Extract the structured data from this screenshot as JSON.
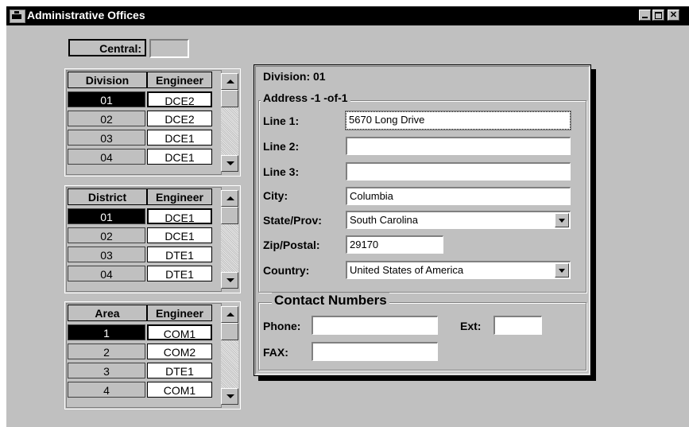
{
  "window": {
    "title": "Administrative Offices"
  },
  "central": {
    "label": "Central:",
    "value": ""
  },
  "division_grid": {
    "headers": [
      "Division",
      "Engineer"
    ],
    "rows": [
      {
        "id": "01",
        "engineer": "DCE2",
        "selected": true
      },
      {
        "id": "02",
        "engineer": "DCE2"
      },
      {
        "id": "03",
        "engineer": "DCE1"
      },
      {
        "id": "04",
        "engineer": "DCE1"
      }
    ]
  },
  "district_grid": {
    "headers": [
      "District",
      "Engineer"
    ],
    "rows": [
      {
        "id": "01",
        "engineer": "DCE1",
        "selected": true
      },
      {
        "id": "02",
        "engineer": "DCE1"
      },
      {
        "id": "03",
        "engineer": "DTE1"
      },
      {
        "id": "04",
        "engineer": "DTE1"
      }
    ]
  },
  "area_grid": {
    "headers": [
      "Area",
      "Engineer"
    ],
    "rows": [
      {
        "id": "1",
        "engineer": "COM1",
        "selected": true
      },
      {
        "id": "2",
        "engineer": "COM2"
      },
      {
        "id": "3",
        "engineer": "DTE1"
      },
      {
        "id": "4",
        "engineer": "COM1"
      }
    ]
  },
  "detail": {
    "division_title": "Division: 01",
    "address_group": "Address -1 -of-1",
    "line1_label": "Line 1:",
    "line1": "5670 Long Drive",
    "line2_label": "Line 2:",
    "line2": "",
    "line3_label": "Line 3:",
    "line3": "",
    "city_label": "City:",
    "city": "Columbia",
    "state_label": "State/Prov:",
    "state": "South Carolina",
    "zip_label": "Zip/Postal:",
    "zip": "29170",
    "country_label": "Country:",
    "country": "United States of America"
  },
  "contact": {
    "group": "Contact Numbers",
    "phone_label": "Phone:",
    "phone": "",
    "ext_label": "Ext:",
    "ext": "",
    "fax_label": "FAX:",
    "fax": ""
  }
}
